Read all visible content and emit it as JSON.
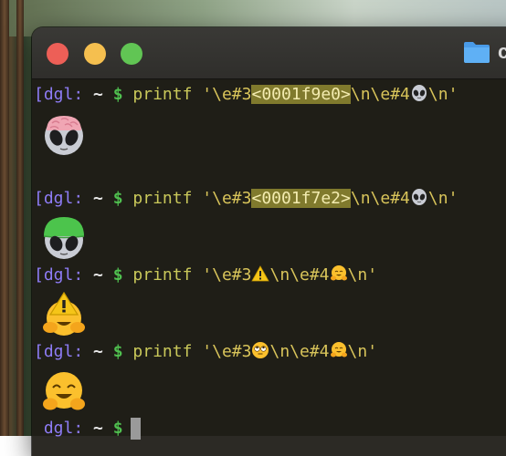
{
  "window": {
    "title": "c",
    "buttons": [
      "close",
      "minimize",
      "maximize"
    ]
  },
  "prompt": {
    "user": "dgl:",
    "dir": "~",
    "symbol": "$"
  },
  "commands": [
    {
      "cmd": "printf",
      "arg_prefix": "'\\e#3",
      "highlight": "<0001f9e0>",
      "arg_mid": "\\n\\e#4",
      "inline_emoji": "alien-icon",
      "arg_suffix": "\\n'",
      "output_emoji": "brain-alien-icon"
    },
    {
      "cmd": "printf",
      "arg_prefix": "'\\e#3",
      "highlight": "<0001f7e2>",
      "arg_mid": "\\n\\e#4",
      "inline_emoji": "alien-icon",
      "arg_suffix": "\\n'",
      "output_emoji": "green-circle-alien-icon"
    },
    {
      "cmd": "printf",
      "arg_prefix": "'\\e#3",
      "inline_emoji_1": "warning-icon",
      "arg_mid": "\\n\\e#4",
      "inline_emoji_2": "hugging-face-icon",
      "arg_suffix": "\\n'",
      "output_emoji": "warning-hugging-face-icon"
    },
    {
      "cmd": "printf",
      "arg_prefix": "'\\e#3",
      "inline_emoji_1": "rolling-eyes-icon",
      "arg_mid": "\\n\\e#4",
      "inline_emoji_2": "hugging-face-icon",
      "arg_suffix": "\\n'",
      "output_emoji": "rolling-eyes-hugging-face-icon"
    }
  ],
  "colors": {
    "prompt_user": "#8e7cf6",
    "prompt_dollar": "#4fbf4f",
    "command": "#c9c85a",
    "highlight_bg": "#807a2d"
  }
}
